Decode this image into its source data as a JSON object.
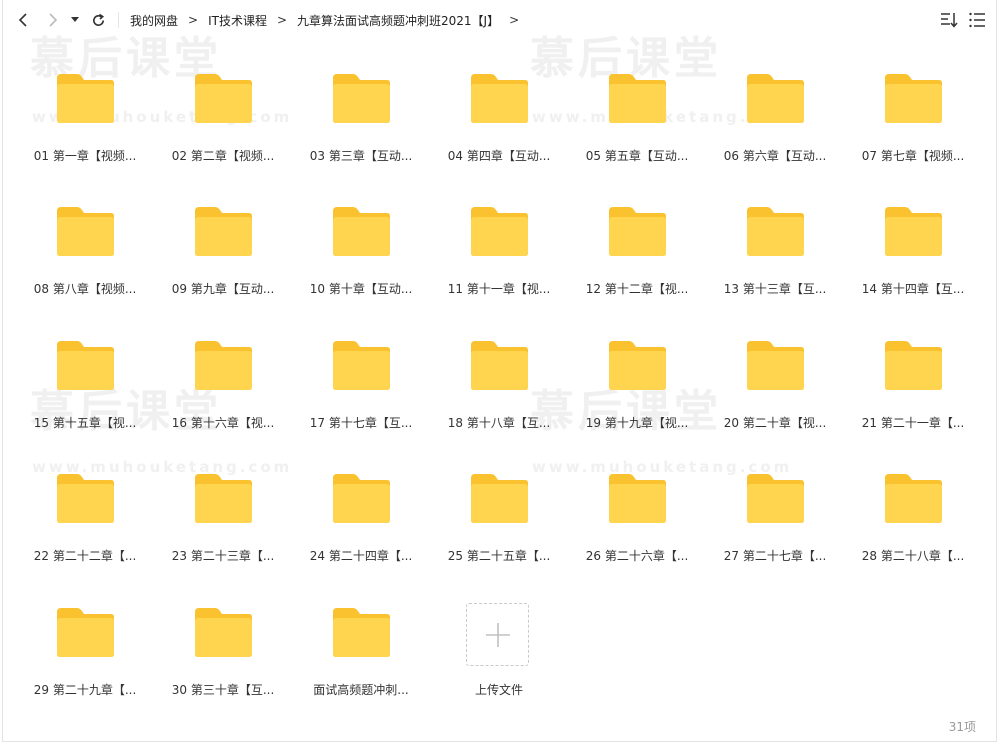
{
  "toolbar": {
    "back_icon": "chevron-left-icon",
    "forward_icon": "chevron-right-icon",
    "history_icon": "caret-down-icon",
    "refresh_icon": "refresh-icon",
    "sort_icon": "sort-icon",
    "view_icon": "list-view-icon"
  },
  "breadcrumb": [
    "我的网盘",
    "IT技术课程",
    "九章算法面试高频题冲刺班2021【J】"
  ],
  "breadcrumb_sep": ">",
  "folders": [
    "01 第一章【视频...",
    "02 第二章【视频...",
    "03 第三章【互动...",
    "04 第四章【互动...",
    "05 第五章【互动...",
    "06 第六章【互动...",
    "07 第七章【视频...",
    "08 第八章【视频...",
    "09 第九章【互动...",
    "10 第十章【互动...",
    "11 第十一章【视...",
    "12 第十二章【视...",
    "13 第十三章【互...",
    "14 第十四章【互...",
    "15 第十五章【视...",
    "16 第十六章【视...",
    "17 第十七章【互...",
    "18 第十八章【互...",
    "19 第十九章【视...",
    "20 第二十章【视...",
    "21 第二十一章【...",
    "22 第二十二章【...",
    "23 第二十三章【...",
    "24 第二十四章【...",
    "25 第二十五章【...",
    "26 第二十六章【...",
    "27 第二十七章【...",
    "28 第二十八章【...",
    "29 第二十九章【...",
    "30 第三十章【互...",
    "面试高频题冲刺..."
  ],
  "upload": {
    "label": "上传文件",
    "icon": "plus-icon"
  },
  "item_count": "31项",
  "watermark": {
    "text": "慕后课堂",
    "url": "www.muhouketang.com"
  },
  "colors": {
    "folder": "#FFD54F",
    "folder_tab": "#F9C22E"
  }
}
